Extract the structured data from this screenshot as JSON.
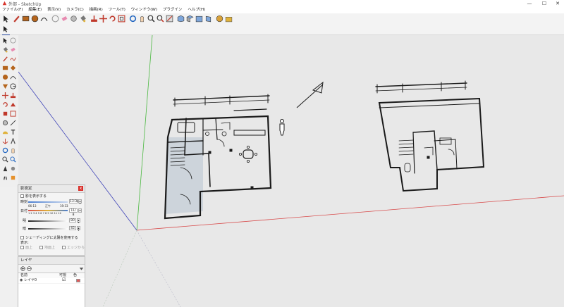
{
  "window": {
    "title": "外部 - SketchUp",
    "minimize": "—",
    "maximize": "☐",
    "close": "✕"
  },
  "menubar": [
    {
      "label": "ファイル(F)"
    },
    {
      "label": "編集(E)"
    },
    {
      "label": "表示(V)"
    },
    {
      "label": "カメラ(C)"
    },
    {
      "label": "描画(R)"
    },
    {
      "label": "ツール(T)"
    },
    {
      "label": "ウィンドウ(W)"
    },
    {
      "label": "プラグイン"
    },
    {
      "label": "ヘルプ(H)"
    }
  ],
  "toolbar2": {
    "badge_label": "3W"
  },
  "shadow_panel": {
    "title": "影設定",
    "close": "x",
    "show_shadows": "影を表示する",
    "time_label": "時刻",
    "time_start": "06:13",
    "time_noon": "正午",
    "time_end": "19:33",
    "time_value": "13:30",
    "date_label": "日付",
    "months": "1 2 3 4 5 6 7 8 9 10 11 12",
    "date_value": "11/ 8",
    "light_label": "明",
    "light_value": "80",
    "dark_label": "暗",
    "dark_value": "45",
    "use_sun_shading": "シェーディングに太陽を使用する",
    "display_label": "表示:",
    "on_faces": "面上",
    "on_ground": "地面上",
    "from_edges": "エッジから"
  },
  "layers_panel": {
    "title": "レイヤ",
    "col_name": "名前",
    "col_visible": "可視",
    "col_color": "色",
    "layers": [
      {
        "name": "レイヤ0",
        "visible": true,
        "color": "#e05a5a"
      }
    ]
  },
  "colors": {
    "viewport_bg": "#e8e8e8",
    "axis_green": "#49b83f",
    "axis_red": "#d84b4b",
    "axis_blue": "#3f44b8",
    "sketch": "#1a1a1a"
  }
}
